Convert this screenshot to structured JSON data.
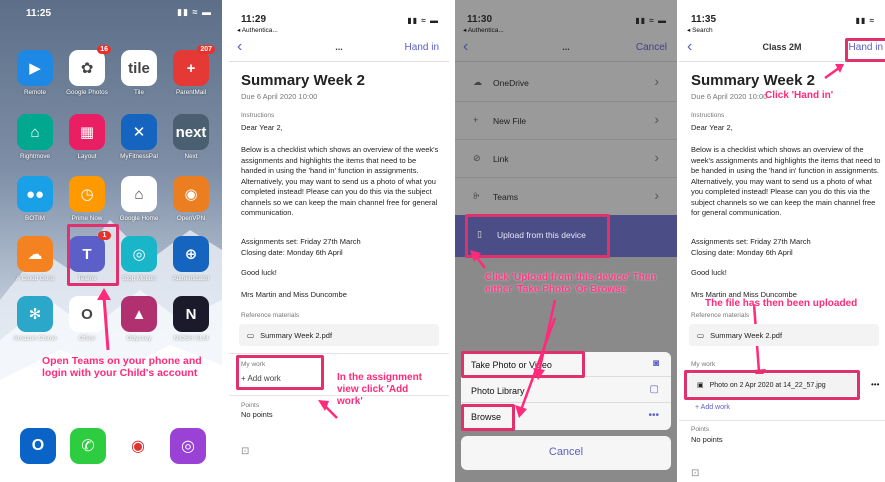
{
  "panel1": {
    "time": "11:25",
    "status_icons": "▮▮ ≈ ▬",
    "apps": [
      {
        "label": "Remote",
        "glyph": "▶",
        "color": "#1e88e5",
        "badge": ""
      },
      {
        "label": "Google Photos",
        "glyph": "✿",
        "color": "#ffffff",
        "badge": "16"
      },
      {
        "label": "Tile",
        "glyph": "tile",
        "color": "#ffffff",
        "badge": ""
      },
      {
        "label": "ParentMail",
        "glyph": "+",
        "color": "#e53935",
        "badge": "207"
      },
      {
        "label": "Rightmove",
        "glyph": "⌂",
        "color": "#00a890",
        "badge": ""
      },
      {
        "label": "Layout",
        "glyph": "▦",
        "color": "#e91e63",
        "badge": ""
      },
      {
        "label": "MyFitnessPal",
        "glyph": "✕",
        "color": "#1565c0",
        "badge": ""
      },
      {
        "label": "Next",
        "glyph": "next",
        "color": "#4a6070",
        "badge": ""
      },
      {
        "label": "BOTIM",
        "glyph": "●●",
        "color": "#1aa0e6",
        "badge": ""
      },
      {
        "label": "Prime Now",
        "glyph": "◷",
        "color": "#ff9900",
        "badge": ""
      },
      {
        "label": "Google Home",
        "glyph": "⌂",
        "color": "#ffffff",
        "badge": ""
      },
      {
        "label": "OpenVPN",
        "glyph": "◉",
        "color": "#ea7e20",
        "badge": ""
      },
      {
        "label": "A Cloud Guru",
        "glyph": "☁",
        "color": "#f58220",
        "badge": ""
      },
      {
        "label": "Teams",
        "glyph": "T",
        "color": "#5b5fc7",
        "badge": "1"
      },
      {
        "label": "Stop Motion",
        "glyph": "◎",
        "color": "#19b5c8",
        "badge": ""
      },
      {
        "label": "Authenticator",
        "glyph": "⊕",
        "color": "#1565c0",
        "badge": ""
      },
      {
        "label": "Amazon Chime",
        "glyph": "✻",
        "color": "#2aa7c9",
        "badge": ""
      },
      {
        "label": "Office",
        "glyph": "O",
        "color": "#ffffff",
        "badge": ""
      },
      {
        "label": "Odyssey",
        "glyph": "▲",
        "color": "#b03070",
        "badge": ""
      },
      {
        "label": "NIOSH SLM",
        "glyph": "N",
        "color": "#1a1a2a",
        "badge": ""
      }
    ],
    "dock": [
      {
        "name": "outlook",
        "glyph": "O",
        "color": "#0a64c8"
      },
      {
        "name": "phone",
        "glyph": "✆",
        "color": "#2ecc40"
      },
      {
        "name": "chrome",
        "glyph": "◉",
        "color": "#ffffff"
      },
      {
        "name": "podcasts",
        "glyph": "◎",
        "color": "#9b42d6"
      }
    ],
    "note": "Open Teams on your phone and login with your Child's account"
  },
  "panel2": {
    "time": "11:29",
    "back": "◂ Authentica...",
    "status_icons": "▮▮ ≈ ▬",
    "nav_mid": "...",
    "hand_in": "Hand in",
    "title": "Summary Week 2",
    "due": "Due 6 April 2020 10:00",
    "instructions_label": "Instructions",
    "greeting": "Dear Year 2,",
    "body": "Below is a checklist which shows an overview of the week's assignments and highlights the items that need to be handed in using the 'hand in' function in assignments.  Alternatively, you may want to send us a photo of what you completed instead! Please can you do this via the subject channels so we can keep the main channel free for general communication.",
    "set": "Assignments set: Friday 27th March",
    "closing": "Closing date: Monday 6th April",
    "luck": "Good luck!",
    "signoff": "Mrs Martin and Miss Duncombe",
    "ref_label": "Reference materials",
    "ref_file": "Summary Week 2.pdf",
    "my_work": "My work",
    "add_work": "+ Add work",
    "points_label": "Points",
    "points": "No points",
    "note": "In the assignment view click 'Add work'"
  },
  "panel3": {
    "time": "11:30",
    "back": "◂ Authentica...",
    "status_icons": "▮▮ ≈ ▬",
    "nav_mid": "...",
    "cancel": "Cancel",
    "rows": [
      {
        "icon": "☁",
        "label": "OneDrive"
      },
      {
        "icon": "+",
        "label": "New File"
      },
      {
        "icon": "⊘",
        "label": "Link"
      },
      {
        "icon": "ꔬ",
        "label": "Teams"
      }
    ],
    "upload": "Upload from this device",
    "note": "Click 'Upload from this device' Then either 'Take Photo' Or Browse",
    "sheet": [
      {
        "label": "Take Photo or Video",
        "icon": "◙"
      },
      {
        "label": "Photo Library",
        "icon": "▢"
      },
      {
        "label": "Browse",
        "icon": "•••"
      }
    ],
    "cancel_btn": "Cancel"
  },
  "panel4": {
    "time": "11:35",
    "back": "◂ Search",
    "status_icons": "▮▮ ≈",
    "nav_title": "Class 2M",
    "hand_in": "Hand in",
    "title": "Summary Week 2",
    "due": "Due 6 April 2020 10:00",
    "hand_in_note": "Click 'Hand in'",
    "instructions_label": "Instructions",
    "greeting": "Dear Year 2,",
    "body": "Below is a checklist which shows an overview of the week's assignments and highlights the items that need to be handed in using the 'hand in' function in assignments.  Alternatively, you may want to send us a photo of what you completed instead! Please can you do this via the subject channels so we can keep the main channel free for general communication.",
    "set": "Assignments set: Friday 27th March",
    "closing": "Closing date: Monday 6th April",
    "luck": "Good luck!",
    "signoff": "Mrs Martin and Miss Duncombe",
    "ref_label": "Reference materials",
    "ref_file": "Summary Week 2.pdf",
    "my_work": "My work",
    "uploaded_file": "Photo on 2 Apr 2020 at 14_22_57.jpg",
    "more": "•••",
    "add_work": "+ Add work",
    "points_label": "Points",
    "points": "No points",
    "note": "The file has then been uploaded"
  },
  "colors": {
    "accent": "#5b5fc7",
    "annotation": "#ff2a7a",
    "highlight_border": "#e0306e"
  }
}
